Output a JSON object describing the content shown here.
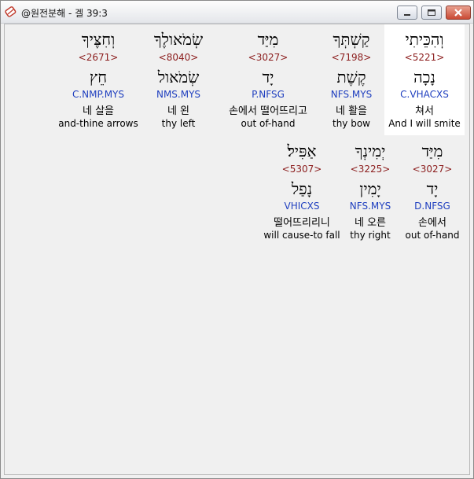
{
  "window": {
    "title": "@원전분해 - 겔 39:3",
    "app_icon": "scroll-icon"
  },
  "row1": [
    {
      "hebrew": "וְהִכֵּיתִי",
      "strong": "<5221>",
      "lexeme": "נָכָה",
      "morph": "C.VHACXS",
      "korean": "쳐서",
      "english": "And I will smite"
    },
    {
      "hebrew": "קַשְׁתְּךָ",
      "strong": "<7198>",
      "lexeme": "קֶשֶׁת",
      "morph": "NFS.MYS",
      "korean": "네 활을",
      "english": "thy bow"
    },
    {
      "hebrew": "מִיַּד",
      "strong": "<3027>",
      "lexeme": "יָד",
      "morph": "P.NFSG",
      "korean": "손에서 떨어뜨리고",
      "english": "out of-hand"
    },
    {
      "hebrew": "שְׂמֹאולֶךָ",
      "strong": "<8040>",
      "lexeme": "שְׂמֹאול",
      "morph": "NMS.MYS",
      "korean": "네 왼",
      "english": "thy left"
    },
    {
      "hebrew": "וְחִצֶּיךָ",
      "strong": "<2671>",
      "lexeme": "חֵץ",
      "morph": "C.NMP.MYS",
      "korean": "네 살을",
      "english": "and-thine arrows"
    }
  ],
  "row2": [
    {
      "hebrew": "מִיַּד",
      "strong": "<3027>",
      "lexeme": "יָד",
      "morph": "D.NFSG",
      "korean": "손에서",
      "english": "out of-hand"
    },
    {
      "hebrew": "יְמִינְךָ",
      "strong": "<3225>",
      "lexeme": "יָמִין",
      "morph": "NFS.MYS",
      "korean": "네 오른",
      "english": "thy right"
    },
    {
      "hebrew": "אַפִּיל׃",
      "strong": "<5307>",
      "lexeme": "נָפַל",
      "morph": "VHICXS",
      "korean": "떨어뜨리리니",
      "english": "will cause-to fall"
    }
  ]
}
